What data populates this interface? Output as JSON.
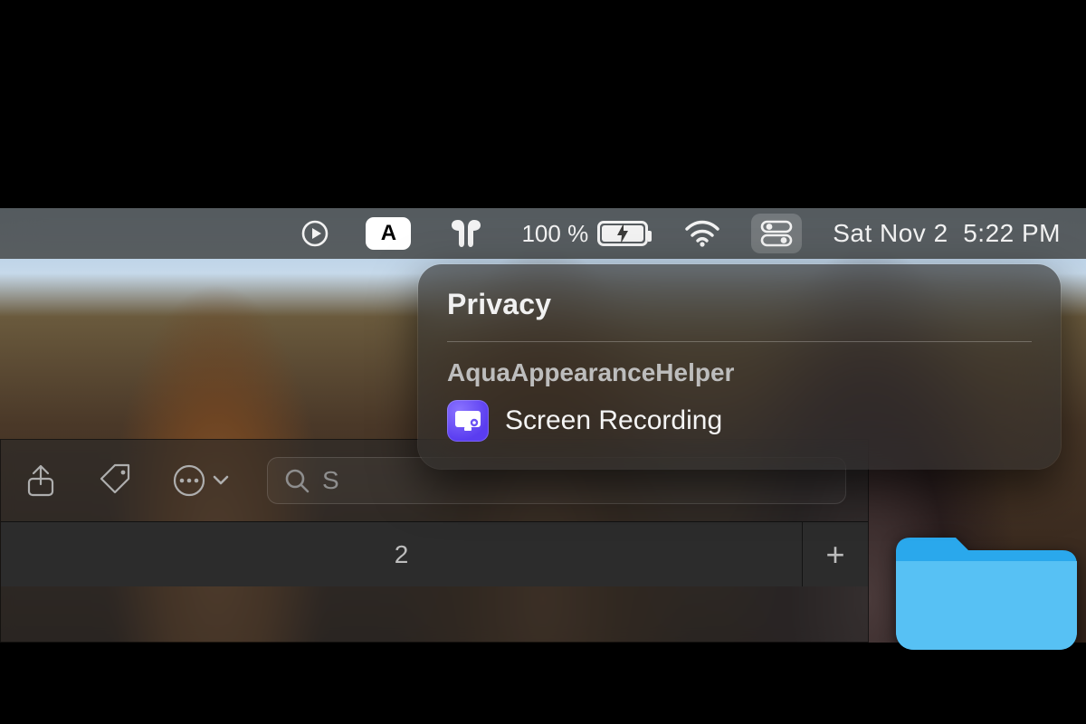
{
  "menubar": {
    "battery_text": "100 %",
    "date": "Sat Nov 2",
    "time": "5:22 PM"
  },
  "popover": {
    "title": "Privacy",
    "app_name": "AquaAppearanceHelper",
    "permission_label": "Screen Recording"
  },
  "finder": {
    "search_prefix": "S",
    "tab_label": "2"
  },
  "icons": {
    "now_playing": "now-playing-icon",
    "input_source": "A",
    "airpods": "airpods-icon",
    "wifi": "wifi-icon",
    "control_center": "control-center-icon",
    "share": "share-icon",
    "tags": "tags-icon",
    "more": "ellipsis-icon",
    "search": "magnifying-glass-icon",
    "plus": "+",
    "screen_record": "screen-recording-icon"
  }
}
